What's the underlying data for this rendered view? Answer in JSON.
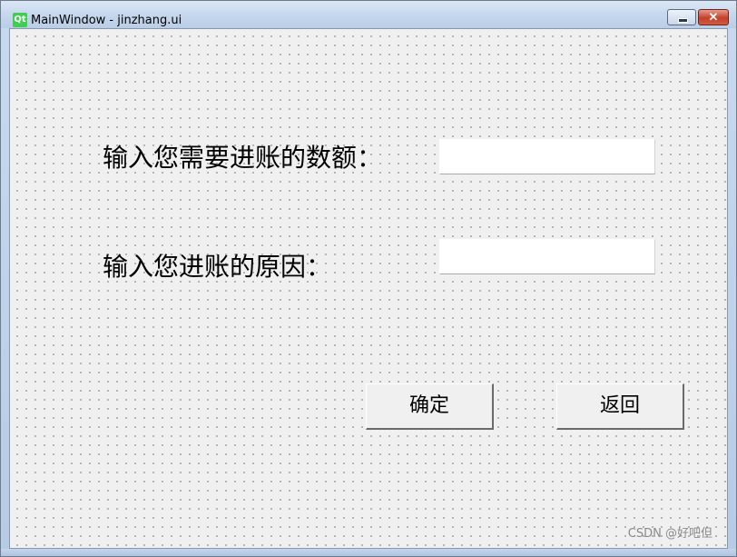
{
  "window": {
    "title": "MainWindow - jinzhang.ui",
    "icon_text": "Qt"
  },
  "form": {
    "amount_label": "输入您需要进账的数额：",
    "amount_value": "",
    "reason_label": "输入您进账的原因：",
    "reason_value": ""
  },
  "buttons": {
    "confirm": "确定",
    "back": "返回"
  },
  "watermark": "CSDN @好吧但",
  "colors": {
    "client_bg": "#f0f0f0",
    "grid_dot": "#a0a0a0",
    "close_button": "#c4402a",
    "qt_icon": "#41cd52"
  }
}
